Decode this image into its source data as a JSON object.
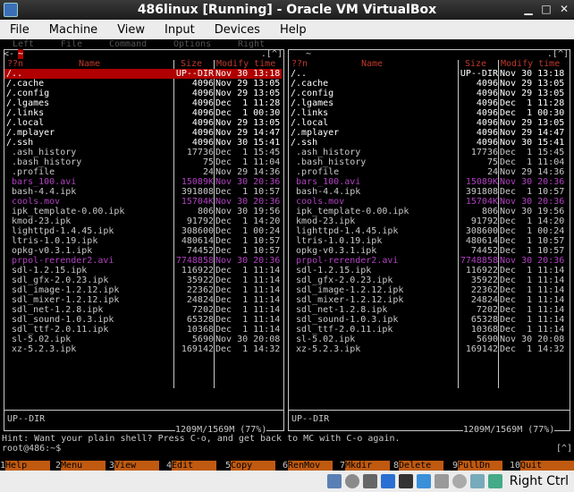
{
  "window": {
    "title": "486linux [Running] - Oracle VM VirtualBox"
  },
  "menubar": [
    "File",
    "Machine",
    "View",
    "Input",
    "Devices",
    "Help"
  ],
  "mc": {
    "top_menu": [
      "Left",
      "File",
      "Command",
      "Options",
      "Right"
    ],
    "panels": [
      {
        "path_header": "~",
        "nav_right": ".[^]",
        "columns": {
          "name_prefix": "??n",
          "name": "Name",
          "size": "Size",
          "time": "Modify time"
        },
        "mini_status": "UP--DIR",
        "disk": "1209M/1569M (77%)"
      },
      {
        "path_header": "~",
        "nav_right": ".[^]",
        "columns": {
          "name_prefix": "??n",
          "name": "Name",
          "size": "Size",
          "time": "Modify time"
        },
        "mini_status": "UP--DIR",
        "disk": "1209M/1569M (77%)"
      }
    ],
    "files": [
      {
        "name": "/..",
        "size": "UP--DIR",
        "time": "Nov 30 13:18",
        "kind": "dir"
      },
      {
        "name": "/.cache",
        "size": "4096",
        "time": "Nov 29 13:05",
        "kind": "dir"
      },
      {
        "name": "/.config",
        "size": "4096",
        "time": "Nov 29 13:05",
        "kind": "dir"
      },
      {
        "name": "/.lgames",
        "size": "4096",
        "time": "Dec  1 11:28",
        "kind": "dir"
      },
      {
        "name": "/.links",
        "size": "4096",
        "time": "Dec  1 00:30",
        "kind": "dir"
      },
      {
        "name": "/.local",
        "size": "4096",
        "time": "Nov 29 13:05",
        "kind": "dir"
      },
      {
        "name": "/.mplayer",
        "size": "4096",
        "time": "Nov 29 14:47",
        "kind": "dir"
      },
      {
        "name": "/.ssh",
        "size": "4096",
        "time": "Nov 30 15:41",
        "kind": "dir"
      },
      {
        "name": " .ash_history",
        "size": "17736",
        "time": "Dec  1 15:45",
        "kind": "file"
      },
      {
        "name": " .bash_history",
        "size": "75",
        "time": "Dec  1 11:04",
        "kind": "file"
      },
      {
        "name": " .profile",
        "size": "24",
        "time": "Nov 29 14:36",
        "kind": "file"
      },
      {
        "name": " bars_100.avi",
        "size": "15089K",
        "time": "Nov 30 20:36",
        "kind": "media"
      },
      {
        "name": " bash-4.4.ipk",
        "size": "391808",
        "time": "Dec  1 10:57",
        "kind": "file"
      },
      {
        "name": " cools.mov",
        "size": "15704K",
        "time": "Nov 30 20:36",
        "kind": "media"
      },
      {
        "name": " ipk_template-0.00.ipk",
        "size": "806",
        "time": "Nov 30 19:56",
        "kind": "file"
      },
      {
        "name": " kmod-23.ipk",
        "size": "91792",
        "time": "Dec  1 14:20",
        "kind": "file"
      },
      {
        "name": " lighttpd-1.4.45.ipk",
        "size": "308600",
        "time": "Dec  1 00:24",
        "kind": "file"
      },
      {
        "name": " ltris-1.0.19.ipk",
        "size": "480614",
        "time": "Dec  1 10:57",
        "kind": "file"
      },
      {
        "name": " opkg-v0.3.1.ipk",
        "size": "74452",
        "time": "Dec  1 10:57",
        "kind": "file"
      },
      {
        "name": " prpol-rerender2.avi",
        "size": "7748858",
        "time": "Nov 30 20:36",
        "kind": "media"
      },
      {
        "name": " sdl-1.2.15.ipk",
        "size": "116922",
        "time": "Dec  1 11:14",
        "kind": "file"
      },
      {
        "name": " sdl_gfx-2.0.23.ipk",
        "size": "35922",
        "time": "Dec  1 11:14",
        "kind": "file"
      },
      {
        "name": " sdl_image-1.2.12.ipk",
        "size": "22362",
        "time": "Dec  1 11:14",
        "kind": "file"
      },
      {
        "name": " sdl_mixer-1.2.12.ipk",
        "size": "24824",
        "time": "Dec  1 11:14",
        "kind": "file"
      },
      {
        "name": " sdl_net-1.2.8.ipk",
        "size": "7202",
        "time": "Dec  1 11:14",
        "kind": "file"
      },
      {
        "name": " sdl_sound-1.0.3.ipk",
        "size": "65328",
        "time": "Dec  1 11:14",
        "kind": "file"
      },
      {
        "name": " sdl_ttf-2.0.11.ipk",
        "size": "10368",
        "time": "Dec  1 11:14",
        "kind": "file"
      },
      {
        "name": " sl-5.02.ipk",
        "size": "5690",
        "time": "Nov 30 20:08",
        "kind": "file"
      },
      {
        "name": " xz-5.2.3.ipk",
        "size": "169142",
        "time": "Dec  1 14:32",
        "kind": "file"
      }
    ],
    "hint": "Hint: Want your plain shell? Press C-o, and get back to MC with C-o again.",
    "prompt": "root@486:~$",
    "cmd_right": "[^]",
    "fkeys": [
      {
        "num": "1",
        "label": "Help"
      },
      {
        "num": "2",
        "label": "Menu"
      },
      {
        "num": "3",
        "label": "View"
      },
      {
        "num": "4",
        "label": "Edit"
      },
      {
        "num": "5",
        "label": "Copy"
      },
      {
        "num": "6",
        "label": "RenMov"
      },
      {
        "num": "7",
        "label": "Mkdir"
      },
      {
        "num": "8",
        "label": "Delete"
      },
      {
        "num": "9",
        "label": "PullDn"
      },
      {
        "num": "10",
        "label": "Quit"
      }
    ]
  },
  "statusbar": {
    "icons": [
      "hdd-icon",
      "optical-icon",
      "audio-icon",
      "network-icon",
      "usb-icon",
      "shared-folder-icon",
      "display-icon",
      "video-capture-icon",
      "cpu-icon",
      "mouse-integration-icon"
    ],
    "colors": {
      "hdd": "#5a7fb5",
      "accent_blue": "#2a6fd1",
      "panel_bg": "#000000",
      "selection": "#b00000",
      "fkey": "#c05a10",
      "media": "#b040c0",
      "header_red": "#c0392b"
    },
    "host_key": "Right Ctrl"
  }
}
